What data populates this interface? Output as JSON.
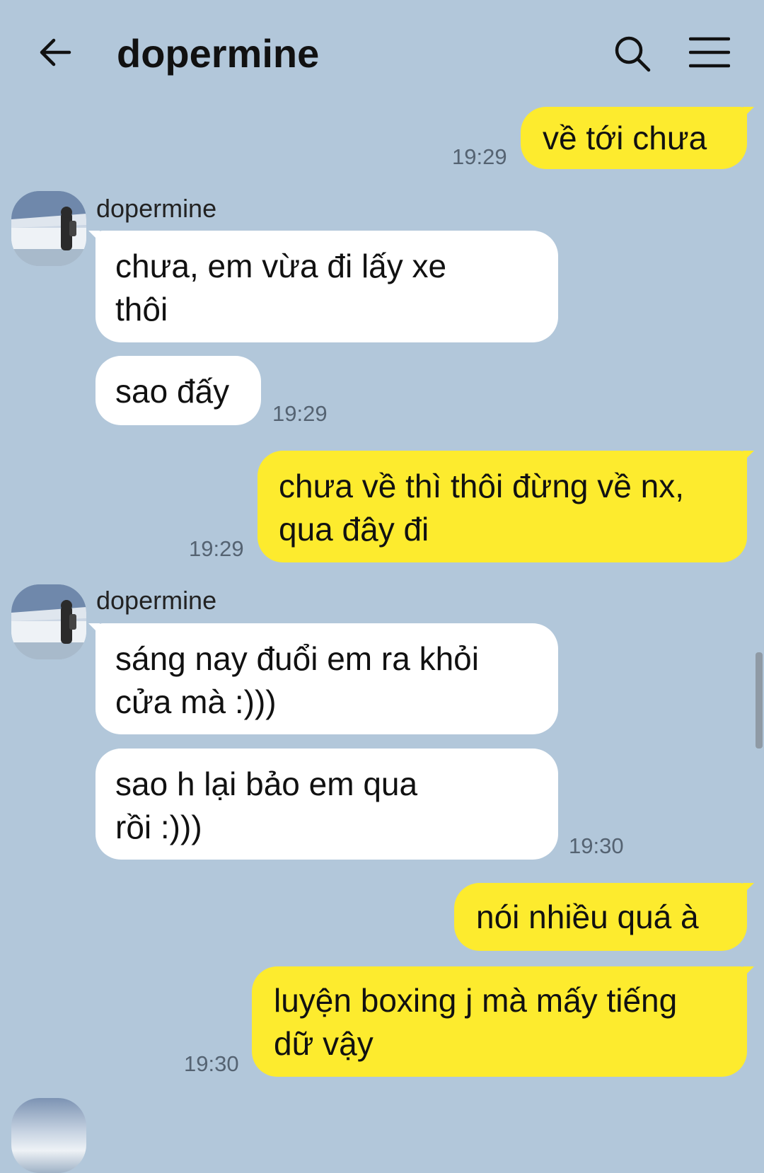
{
  "header": {
    "title": "dopermine",
    "back_icon": "arrow-left-icon",
    "search_icon": "search-icon",
    "menu_icon": "hamburger-menu-icon"
  },
  "messages": [
    {
      "direction": "out",
      "text": "về tới chưa",
      "time": "19:29"
    },
    {
      "direction": "in",
      "sender": "dopermine",
      "text": "chưa, em vừa đi lấy xe\nthôi"
    },
    {
      "direction": "in",
      "text": "sao đấy",
      "time": "19:29"
    },
    {
      "direction": "out",
      "text": "chưa về thì thôi đừng về nx,\nqua đây đi",
      "time": "19:29"
    },
    {
      "direction": "in",
      "sender": "dopermine",
      "text": "sáng nay đuổi em ra khỏi\ncửa mà :)))"
    },
    {
      "direction": "in",
      "text": "sao h lại bảo em qua\nrồi :)))",
      "time": "19:30"
    },
    {
      "direction": "out",
      "text": "nói nhiều quá à"
    },
    {
      "direction": "out",
      "text": "luyện boxing j mà mấy tiếng\ndữ vậy",
      "time": "19:30"
    }
  ],
  "colors": {
    "background": "#b2c7da",
    "outgoing_bubble": "#fdeb2e",
    "incoming_bubble": "#ffffff",
    "timestamp": "#556372"
  }
}
